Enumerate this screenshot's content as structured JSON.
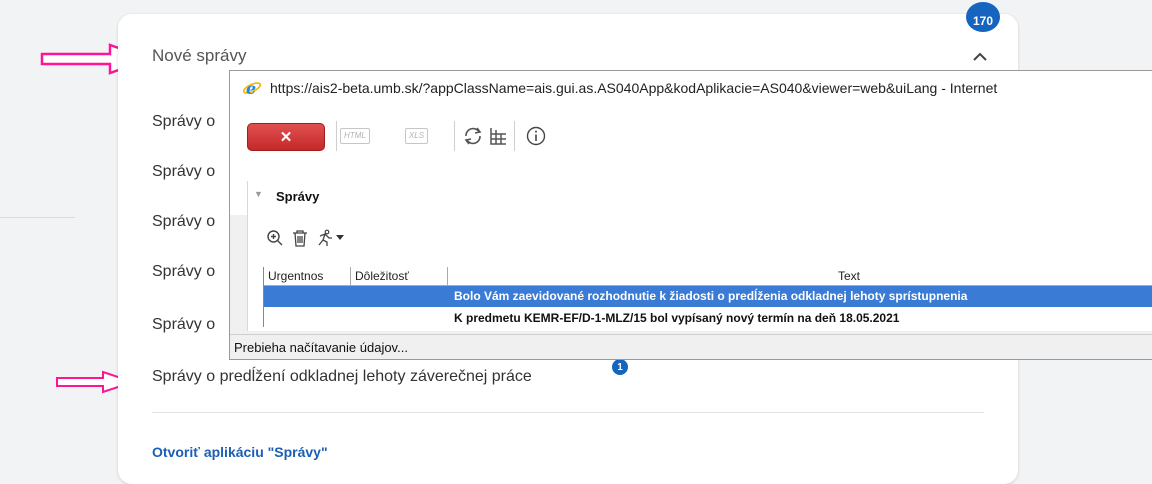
{
  "card": {
    "badge_total": "170",
    "title": "Nové správy",
    "messages": [
      "Správy o",
      "Správy o",
      "Správy o",
      "Správy o",
      "Správy o",
      "Správy o predĺžení odkladnej lehoty záverečnej práce"
    ],
    "last_badge": "1",
    "open_link": "Otvoriť aplikáciu \"Správy\""
  },
  "popup": {
    "url": "https://ais2-beta.umb.sk/?appClassName=ais.gui.as.AS040App&kodAplikacie=AS040&viewer=web&uiLang - Internet",
    "close_label": "✕",
    "html_label": "HTML",
    "xls_label": "XLS",
    "panel_title": "Správy",
    "columns": [
      "Urgentnos",
      "Dôležitosť",
      "Text"
    ],
    "rows": [
      "Bolo Vám zaevidované rozhodnutie k žiadosti o predĺženia odkladnej lehoty sprístupnenia",
      "K predmetu KEMR-EF/D-1-MLZ/15 bol vypísaný nový termín na deň 18.05.2021"
    ],
    "status": "Prebieha načítavanie údajov..."
  },
  "colors": {
    "accent": "#1565c0",
    "selection": "#3a7bd5",
    "annotation_arrow": "#ff1493"
  },
  "icons": [
    "pink-arrow-icon",
    "chevron-up-icon",
    "ie-logo-icon",
    "refresh-icon",
    "table-icon",
    "info-icon",
    "zoom-in-icon",
    "trash-icon",
    "run-icon",
    "caret-down-icon"
  ]
}
